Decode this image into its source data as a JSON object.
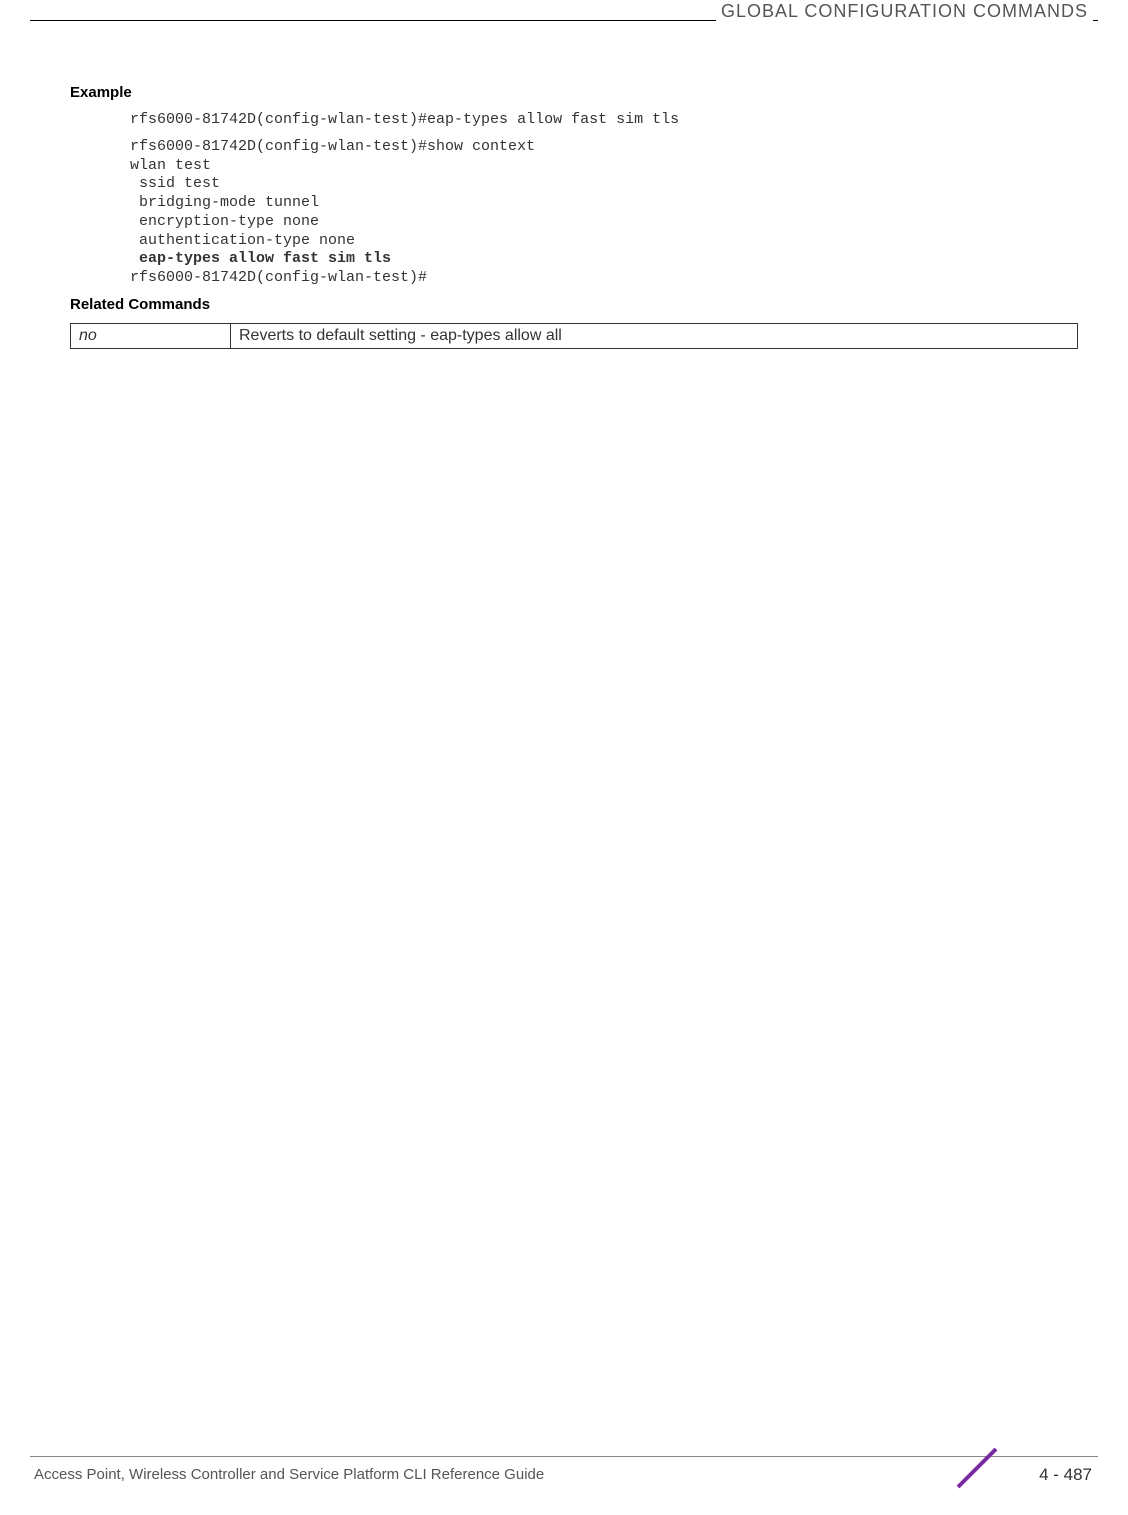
{
  "header": {
    "title": "GLOBAL CONFIGURATION COMMANDS"
  },
  "section": {
    "example_heading": "Example",
    "code1": "rfs6000-81742D(config-wlan-test)#eap-types allow fast sim tls",
    "code2_l1": "rfs6000-81742D(config-wlan-test)#show context",
    "code2_l2": "wlan test",
    "code2_l3": " ssid test",
    "code2_l4": " bridging-mode tunnel",
    "code2_l5": " encryption-type none",
    "code2_l6": " authentication-type none",
    "code2_l7_bold": " eap-types allow fast sim tls",
    "code2_l8": "rfs6000-81742D(config-wlan-test)#",
    "related_heading": "Related Commands",
    "related_cmd": "no",
    "related_desc": "Reverts to default setting - eap-types allow all"
  },
  "footer": {
    "text": "Access Point, Wireless Controller and Service Platform CLI Reference Guide",
    "page": "4 - 487"
  }
}
